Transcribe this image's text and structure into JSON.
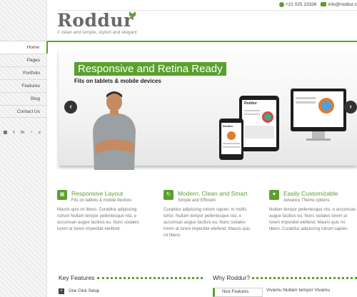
{
  "header": {
    "logo": "Roddur",
    "tagline": "// clean and simple, stylish and elegant",
    "phone": "+21 025 23336",
    "email": "info@roddur.c"
  },
  "nav": {
    "items": [
      {
        "label": "Home",
        "active": true
      },
      {
        "label": "Pages"
      },
      {
        "label": "Portfolio"
      },
      {
        "label": "Features"
      },
      {
        "label": "Blog"
      },
      {
        "label": "Contact Us"
      }
    ]
  },
  "social": [
    "grid-icon",
    "twitter-icon",
    "linkedin-icon",
    "rss-icon",
    "search-icon"
  ],
  "slider": {
    "title": "Responsive and Retina Ready",
    "subtitle": "Fits on tablets & mobile devices",
    "prev": "‹",
    "next": "›",
    "device_logo": "Roddur"
  },
  "features": [
    {
      "title": "Responsive Layout",
      "sub": "Fits on tablets & mobile devices",
      "icon": "grid-icon",
      "text": "Mauris quis mi libero. Curabitur adipiscing rutrum Nullam tempor pellentesque nisi, e accumsan augue facilisis eu. Nunc sodales lorem at lorem imperdiet eleifend."
    },
    {
      "title": "Modern, Clean and Smart",
      "sub": "Simple and Efficient",
      "icon": "refresh-icon",
      "text": "Curabitur adipiscing rutrum sapien, in mollis tortor. Nullam tempor pellentesque nisi, e accumsan augue facilisis eu. Nunc sodales lorem at lorem imperdiet eleifend. Mauris quis mi libero."
    },
    {
      "title": "Easily Customizable",
      "sub": "Advance Theme options",
      "icon": "heart-icon",
      "text": "Nullam tempor pellentesque nisi, e accumsan augue facilisis eu. Nunc sodales lorem at lorem imperdiet eleifend. Mauris quis mi libero. Curabitur adipiscing rutrum sapien."
    }
  ],
  "bottom": {
    "key_features": "Key Features",
    "kf_item": "One Click Setup",
    "why": "Why Roddur?",
    "nice": "Nice Features",
    "nice_text": "Vivamu Nullam tempor Vivamu"
  },
  "colors": {
    "accent": "#5aa02c"
  }
}
